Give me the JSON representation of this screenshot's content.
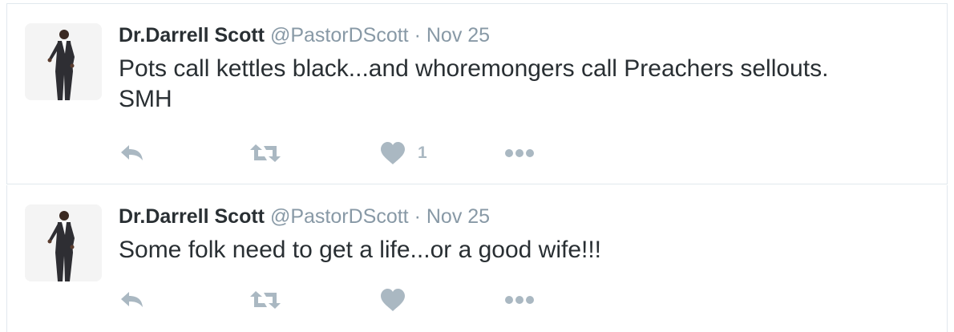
{
  "colors": {
    "icon_gray": "#aab8c2",
    "name_text": "#292f33",
    "meta_text": "#8899a6",
    "border": "#e1e8ed"
  },
  "tweets": [
    {
      "fullname": "Dr.Darrell Scott",
      "username": "@PastorDScott",
      "separator": "·",
      "time": "Nov 25",
      "text_lines": [
        "Pots call kettles black...and whoremongers call Preachers sellouts.",
        "SMH"
      ],
      "like_count": "1",
      "icons": [
        "reply-icon",
        "retweet-icon",
        "heart-icon",
        "more-icon"
      ]
    },
    {
      "fullname": "Dr.Darrell Scott",
      "username": "@PastorDScott",
      "separator": "·",
      "time": "Nov 25",
      "text_lines": [
        "Some folk need to get a life...or a good wife!!!"
      ],
      "like_count": "",
      "icons": [
        "reply-icon",
        "retweet-icon",
        "heart-icon",
        "more-icon"
      ]
    }
  ]
}
